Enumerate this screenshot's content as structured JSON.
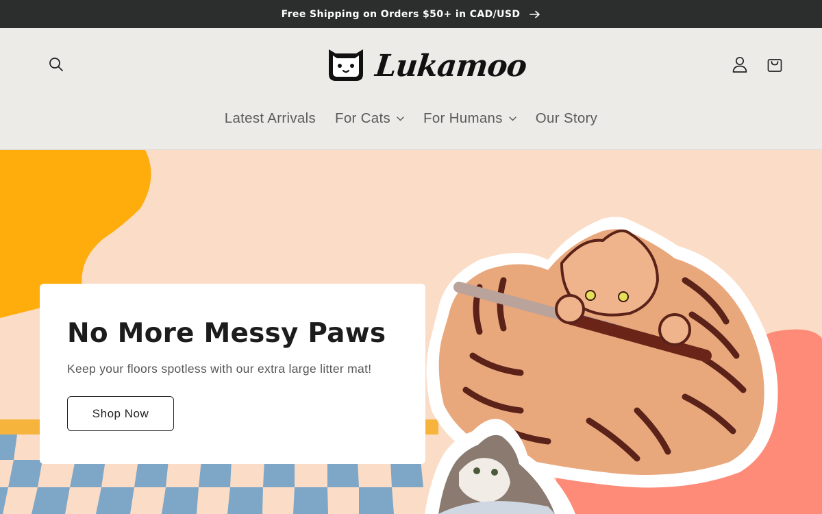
{
  "announcement": {
    "text": "Free Shipping on Orders $50+ in CAD/USD",
    "icon": "arrow-right-icon"
  },
  "header": {
    "logo_text": "Lukamoo",
    "icons": {
      "search": "search-icon",
      "account": "user-icon",
      "cart": "bag-icon"
    },
    "nav": [
      {
        "label": "Latest Arrivals",
        "has_dropdown": false
      },
      {
        "label": "For Cats",
        "has_dropdown": true
      },
      {
        "label": "For Humans",
        "has_dropdown": true
      },
      {
        "label": "Our Story",
        "has_dropdown": false
      }
    ]
  },
  "hero": {
    "title": "No More Messy Paws",
    "subtitle": "Keep your floors spotless with our extra large litter mat!",
    "cta_label": "Shop Now"
  },
  "colors": {
    "announcement_bg": "#2b2e2c",
    "header_bg": "#edebe8",
    "hero_bg": "#fbdcc6",
    "blob_yellow": "#ffad0d",
    "blob_coral": "#fe8a78",
    "checker_blue": "#7ea6c7"
  }
}
